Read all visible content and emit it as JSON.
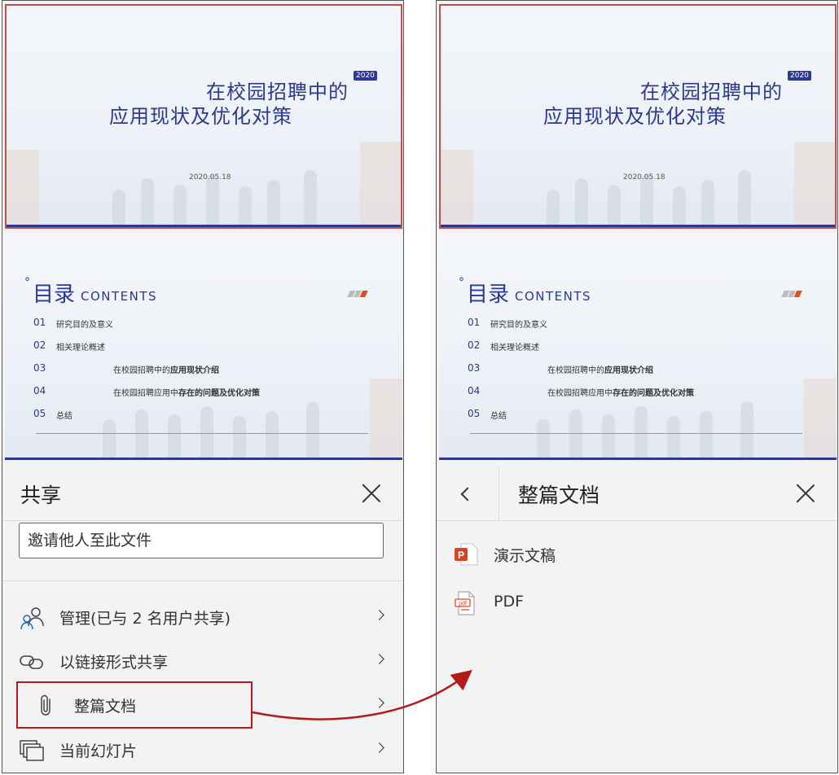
{
  "slides": {
    "title_line1": "在校园招聘中的",
    "title_line2": "应用现状及优化对策",
    "year": "2020",
    "date": "2020.05.18",
    "toc_heading": "目录",
    "toc_heading_deg": "°",
    "toc_english": "CONTENTS",
    "toc_items": [
      {
        "num": "01",
        "text": "研究目的及意义"
      },
      {
        "num": "02",
        "text": "相关理论概述"
      },
      {
        "num": "03",
        "pre": "在校园招聘中的",
        "bold": "应用现状介绍"
      },
      {
        "num": "04",
        "pre": "在校园招聘应用中",
        "bold": "存在的问题及优化对策"
      },
      {
        "num": "05",
        "text": "总结"
      }
    ]
  },
  "share_panel": {
    "title": "共享",
    "invite_placeholder": "邀请他人至此文件",
    "rows": [
      {
        "label": "管理(已与 2 名用户共享)",
        "icon": "people-icon"
      },
      {
        "label": "以链接形式共享",
        "icon": "link-icon"
      },
      {
        "label": "整篇文档",
        "icon": "paperclip-icon"
      },
      {
        "label": "当前幻灯片",
        "icon": "slides-icon"
      }
    ]
  },
  "doc_panel": {
    "title": "整篇文档",
    "options": [
      {
        "label": "演示文稿",
        "icon": "powerpoint-icon"
      },
      {
        "label": "PDF",
        "icon": "pdf-icon"
      }
    ]
  },
  "colors": {
    "accent_navy": "#2b3990",
    "highlight_red": "#b31b1b",
    "slide_select_border": "#c0504d",
    "ppt_orange": "#d24726"
  }
}
